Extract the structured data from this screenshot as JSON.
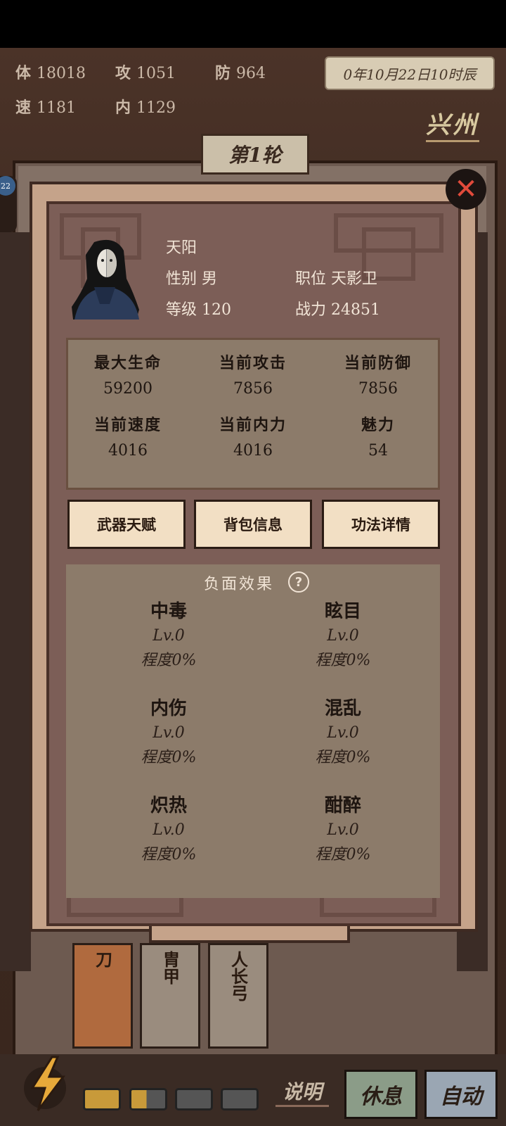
{
  "top_stats": [
    {
      "key": "体",
      "value": "18018"
    },
    {
      "key": "攻",
      "value": "1051"
    },
    {
      "key": "防",
      "value": "964"
    },
    {
      "key": "速",
      "value": "1181"
    },
    {
      "key": "内",
      "value": "1129"
    }
  ],
  "date": "0年10月22日10时辰",
  "location": "兴州",
  "round_label": "第1轮",
  "left_badge": "22",
  "hero": {
    "name": "天阳",
    "gender_label": "性别 男",
    "position_label": "职位 天影卫",
    "level_label": "等级 120",
    "power_label": "战力 24851"
  },
  "stats": [
    {
      "label": "最大生命",
      "value": "59200"
    },
    {
      "label": "当前攻击",
      "value": "7856"
    },
    {
      "label": "当前防御",
      "value": "7856"
    },
    {
      "label": "当前速度",
      "value": "4016"
    },
    {
      "label": "当前内力",
      "value": "4016"
    },
    {
      "label": "魅力",
      "value": "54"
    }
  ],
  "actions": [
    "武器天赋",
    "背包信息",
    "功法详情"
  ],
  "effects_title": "负面效果",
  "help_icon": "?",
  "effects": [
    {
      "name": "中毒",
      "level": "Lv.0",
      "degree": "程度0%"
    },
    {
      "name": "眩目",
      "level": "Lv.0",
      "degree": "程度0%"
    },
    {
      "name": "内伤",
      "level": "Lv.0",
      "degree": "程度0%"
    },
    {
      "name": "混乱",
      "level": "Lv.0",
      "degree": "程度0%"
    },
    {
      "name": "炽热",
      "level": "Lv.0",
      "degree": "程度0%"
    },
    {
      "name": "酣醉",
      "level": "Lv.0",
      "degree": "程度0%"
    }
  ],
  "close_icon": "✕",
  "cards": [
    "刀",
    "胄甲",
    "人长弓"
  ],
  "bottom": {
    "explain": "说明",
    "rest": "休息",
    "auto": "自动"
  },
  "icons": {
    "close": "close-icon",
    "help": "help-icon",
    "energy": "lightning-icon"
  }
}
